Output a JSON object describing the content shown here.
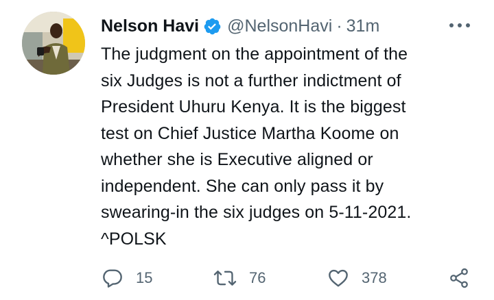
{
  "user": {
    "name": "Nelson Havi",
    "handle": "@NelsonHavi",
    "separator": "·",
    "time": "31m"
  },
  "tweet": {
    "text": "The judgment on the appointment of the\nsix Judges is not a further indictment of\nPresident Uhuru Kenya. It is the biggest\ntest on Chief Justice Martha Koome on\nwhether she is Executive aligned or\nindependent. She can only pass it by\nswearing-in the six judges on 5-11-2021.\n^POLSK"
  },
  "actions": {
    "reply_count": "15",
    "retweet_count": "76",
    "like_count": "378"
  },
  "icons": {
    "verified": "verified-badge-icon",
    "more": "more-options-icon",
    "reply": "reply-icon",
    "retweet": "retweet-icon",
    "like": "heart-icon",
    "share": "share-icon"
  },
  "colors": {
    "text": "#0f1419",
    "muted": "#536471",
    "verified": "#1d9bf0"
  }
}
